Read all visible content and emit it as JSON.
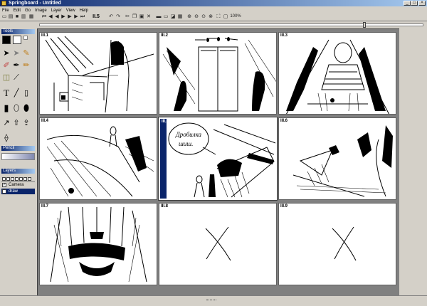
{
  "window": {
    "title": "Springboard - Untitled"
  },
  "menu": [
    "File",
    "Edit",
    "Go",
    "Image",
    "Layer",
    "View",
    "Help"
  ],
  "toolbar": {
    "frame_label": "II.5",
    "zoom": "100%"
  },
  "tools_panel": {
    "header": "Tools"
  },
  "pencil_panel": {
    "header": "Pencil"
  },
  "layers_panel": {
    "header": "Layers",
    "layers": [
      {
        "name": "Camera",
        "visible": true,
        "selected": false
      },
      {
        "name": "draw",
        "visible": true,
        "selected": true
      }
    ]
  },
  "panels": [
    {
      "label": "III.1"
    },
    {
      "label": "III.2"
    },
    {
      "label": "III.3"
    },
    {
      "label": "III.4"
    },
    {
      "label": "III.5"
    },
    {
      "label": "III.6"
    },
    {
      "label": "III.7"
    },
    {
      "label": "III.8"
    },
    {
      "label": "III.9"
    }
  ],
  "panel5_text": [
    "Дробилка",
    "шиш."
  ],
  "colors": {
    "accent": "#0a246a",
    "chrome": "#d4d0c8",
    "workspace": "#808080"
  }
}
